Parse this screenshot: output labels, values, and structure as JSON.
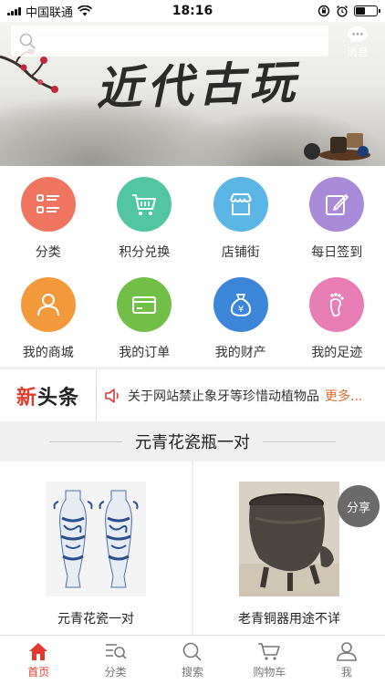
{
  "status_bar": {
    "carrier": "中国联通",
    "time": "18:16"
  },
  "banner": {
    "title": "近代古玩"
  },
  "search": {
    "placeholder": ""
  },
  "header": {
    "message_label": "消息"
  },
  "grid": {
    "items": [
      {
        "label": "分类",
        "icon": "category-list-icon",
        "color": "#f07561"
      },
      {
        "label": "积分兑换",
        "icon": "shopping-cart-icon",
        "color": "#52c6a0"
      },
      {
        "label": "店铺街",
        "icon": "store-icon",
        "color": "#5bb6e6"
      },
      {
        "label": "每日签到",
        "icon": "edit-sign-icon",
        "color": "#a98ad8"
      },
      {
        "label": "我的商城",
        "icon": "person-icon",
        "color": "#f29a3b"
      },
      {
        "label": "我的订单",
        "icon": "card-icon",
        "color": "#72bf47"
      },
      {
        "label": "我的财产",
        "icon": "money-bag-icon",
        "color": "#3b86d9"
      },
      {
        "label": "我的足迹",
        "icon": "footprint-icon",
        "color": "#e77db5"
      }
    ]
  },
  "headline": {
    "logo_xin": "新",
    "logo_tt": "头条",
    "text": "关于网站禁止象牙等珍惜动植物品",
    "more": "更多..."
  },
  "section": {
    "title": "元青花瓷瓶一对"
  },
  "products": [
    {
      "name": "元青花瓷一对"
    },
    {
      "name": "老青铜器用途不详",
      "share": "分享"
    }
  ],
  "tabbar": {
    "items": [
      {
        "label": "首页",
        "active": true
      },
      {
        "label": "分类"
      },
      {
        "label": "搜索"
      },
      {
        "label": "购物车"
      },
      {
        "label": "我"
      }
    ]
  },
  "colors": {
    "accent": "#e23b2e",
    "more": "#e06a2c"
  }
}
